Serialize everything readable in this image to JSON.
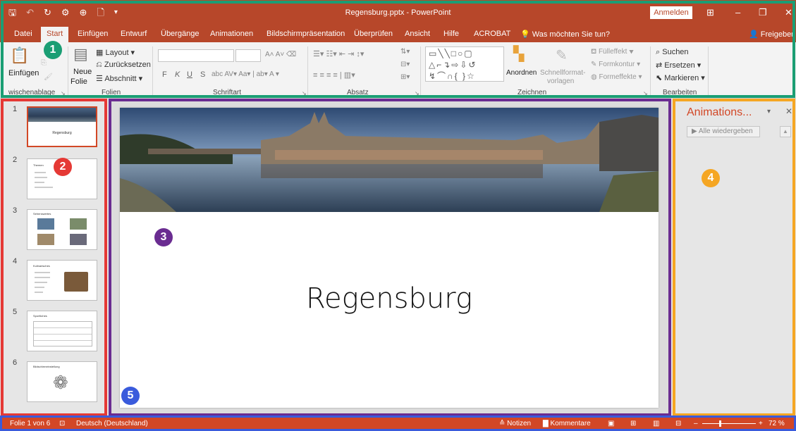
{
  "titlebar": {
    "qat_icons": [
      "save-icon",
      "undo-icon",
      "redo-icon",
      "present-icon",
      "pin-icon",
      "new-icon",
      "customize-icon"
    ],
    "qat_glyphs": [
      "🖫",
      "↶",
      "↻",
      "⚙",
      "⊕",
      "🗋",
      "▾"
    ],
    "title": "Regensburg.pptx - PowerPoint",
    "signin": "Anmelden",
    "restore_glyph": "⊞",
    "minimize_glyph": "–",
    "maximize_glyph": "❐",
    "close_glyph": "✕"
  },
  "tabs": {
    "file": "Datei",
    "start": "Start",
    "insert": "Einfügen",
    "design": "Entwurf",
    "transitions": "Übergänge",
    "animations": "Animationen",
    "slideshow": "Bildschirmpräsentation",
    "review": "Überprüfen",
    "view": "Ansicht",
    "help": "Hilfe",
    "acrobat": "ACROBAT",
    "tellme": "Was möchten Sie tun?",
    "share": "Freigeben"
  },
  "ribbon": {
    "clipboard": {
      "paste": "Einfügen",
      "label": "wischenablage"
    },
    "slides": {
      "new_slide_1": "Neue",
      "new_slide_2": "Folie",
      "layout": "Layout",
      "reset": "Zurücksetzen",
      "section": "Abschnitt",
      "label": "Folien"
    },
    "font": {
      "bold": "F",
      "italic": "K",
      "underline": "U",
      "strike": "S",
      "label": "Schriftart"
    },
    "paragraph": {
      "label": "Absatz"
    },
    "drawing": {
      "arrange": "Anordnen",
      "quickstyles_1": "Schnellformat-",
      "quickstyles_2": "vorlagen",
      "fill": "Fülleffekt",
      "outline": "Formkontur",
      "effects": "Formeffekte",
      "label": "Zeichnen"
    },
    "editing": {
      "find": "Suchen",
      "replace": "Ersetzen",
      "select": "Markieren",
      "label": "Bearbeiten"
    }
  },
  "thumbnails": [
    {
      "num": "1",
      "title": "Regensburg"
    },
    {
      "num": "2",
      "title": "Themen"
    },
    {
      "num": "3",
      "title": "Sehenswertes"
    },
    {
      "num": "4",
      "title": "Kulinarisches"
    },
    {
      "num": "5",
      "title": "Sportliches"
    },
    {
      "num": "6",
      "title": "Bildschirmeinstellung"
    }
  ],
  "slide": {
    "title": "Regensburg"
  },
  "animation_pane": {
    "title": "Animations...",
    "play_all": "Alle wiedergeben"
  },
  "statusbar": {
    "slide_info": "Folie 1 von 6",
    "language": "Deutsch (Deutschland)",
    "notes": "Notizen",
    "comments": "Kommentare",
    "zoom": "72 %"
  },
  "annotations": {
    "badges": [
      "1",
      "2",
      "3",
      "4",
      "5"
    ],
    "colors": {
      "ribbon": "#1a9e74",
      "thumbs": "#e53935",
      "main": "#6a2c91",
      "anim": "#f5a623",
      "status": "#3a5bdc"
    }
  },
  "colors": {
    "accent": "#b7472a",
    "status": "#d24726"
  }
}
